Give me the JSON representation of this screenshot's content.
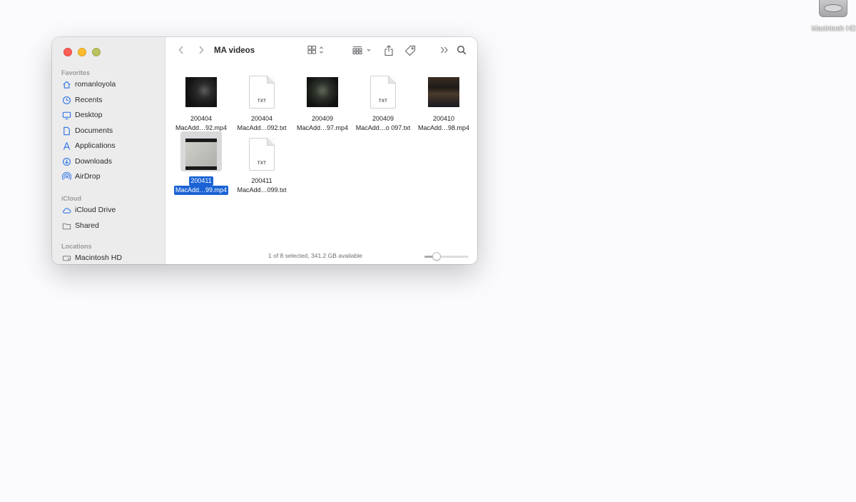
{
  "desktop": {
    "drive_label": "Macintosh HD",
    "drive_icon": "hard-drive-icon"
  },
  "window": {
    "title": "MA videos",
    "sidebar": {
      "favorites_header": "Favorites",
      "favorites": [
        {
          "label": "romanloyola",
          "icon": "home-icon"
        },
        {
          "label": "Recents",
          "icon": "clock-icon"
        },
        {
          "label": "Desktop",
          "icon": "desktop-icon"
        },
        {
          "label": "Documents",
          "icon": "document-icon"
        },
        {
          "label": "Applications",
          "icon": "applications-icon"
        },
        {
          "label": "Downloads",
          "icon": "download-icon"
        },
        {
          "label": "AirDrop",
          "icon": "airdrop-icon"
        }
      ],
      "icloud_header": "iCloud",
      "icloud": [
        {
          "label": "iCloud Drive",
          "icon": "cloud-icon"
        },
        {
          "label": "Shared",
          "icon": "shared-folder-icon"
        }
      ],
      "locations_header": "Locations",
      "locations": [
        {
          "label": "Macintosh HD",
          "icon": "disk-icon"
        }
      ]
    },
    "files": [
      {
        "line1": "200404",
        "line2": "MacAdd…92.mp4",
        "type": "video",
        "selected": false
      },
      {
        "line1": "200404",
        "line2": "MacAdd…092.txt",
        "type": "txt",
        "badge": "TXT",
        "selected": false
      },
      {
        "line1": "200409",
        "line2": "MacAdd…97.mp4",
        "type": "video",
        "selected": false
      },
      {
        "line1": "200409",
        "line2": "MacAdd…o 097.txt",
        "type": "txt",
        "badge": "TXT",
        "selected": false
      },
      {
        "line1": "200410",
        "line2": "MacAdd…98.mp4",
        "type": "video",
        "selected": false
      },
      {
        "line1": "200411",
        "line2": "MacAdd…99.mp4",
        "type": "video",
        "selected": true
      },
      {
        "line1": "200411",
        "line2": "MacAdd…099.txt",
        "type": "txt",
        "badge": "TXT",
        "selected": false
      }
    ],
    "status": "1 of 8 selected, 341.2 GB available",
    "icon_size_level": 0.25,
    "colors": {
      "selection": "#1b63d4",
      "sidebar_icon": "#3b7be5",
      "close": "#ff5f57",
      "minimize": "#febc2e"
    }
  }
}
